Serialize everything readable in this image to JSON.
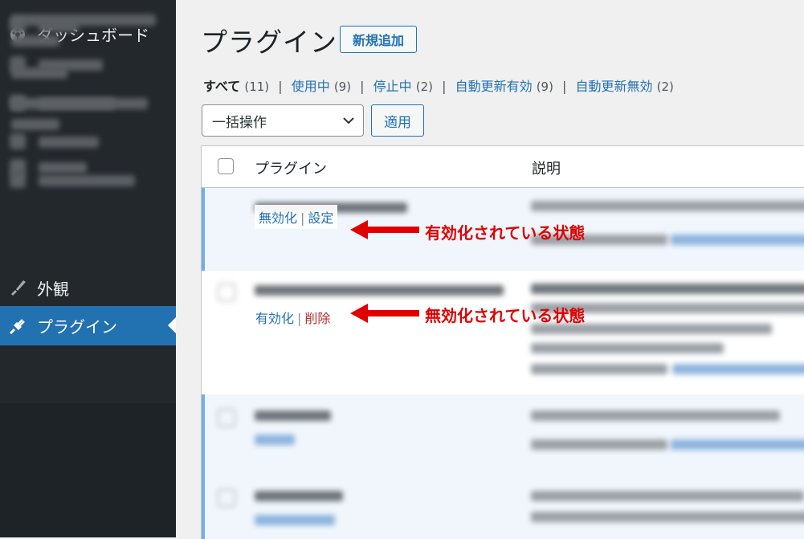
{
  "sidebar": {
    "dashboard": {
      "label": "ダッシュボード",
      "icon": "dashboard-gauge-icon"
    },
    "appearance": {
      "label": "外観",
      "icon": "paintbrush-icon"
    },
    "plugins": {
      "label": "プラグイン",
      "icon": "plugin-icon",
      "active": true
    }
  },
  "page": {
    "title": "プラグイン",
    "add_new_label": "新規追加"
  },
  "filters": [
    {
      "label": "すべて",
      "count": "(11)",
      "current": true
    },
    {
      "label": "使用中",
      "count": "(9)"
    },
    {
      "label": "停止中",
      "count": "(2)"
    },
    {
      "label": "自動更新有効",
      "count": "(9)"
    },
    {
      "label": "自動更新無効",
      "count": "(2)"
    }
  ],
  "bulk": {
    "select_value": "一括操作",
    "apply_label": "適用"
  },
  "table": {
    "headers": {
      "plugin": "プラグイン",
      "description": "説明"
    },
    "row_actions": {
      "active": {
        "deactivate": "無効化",
        "settings": "設定"
      },
      "inactive": {
        "activate": "有効化",
        "delete": "削除"
      }
    }
  },
  "annotations": {
    "active_state": "有効化されている状態",
    "inactive_state": "無効化されている状態",
    "color": "#e00000"
  },
  "colors": {
    "sidebar_bg": "#1d2327",
    "active_menu": "#2271b1",
    "link": "#2271b1",
    "delete": "#b32d2e"
  }
}
